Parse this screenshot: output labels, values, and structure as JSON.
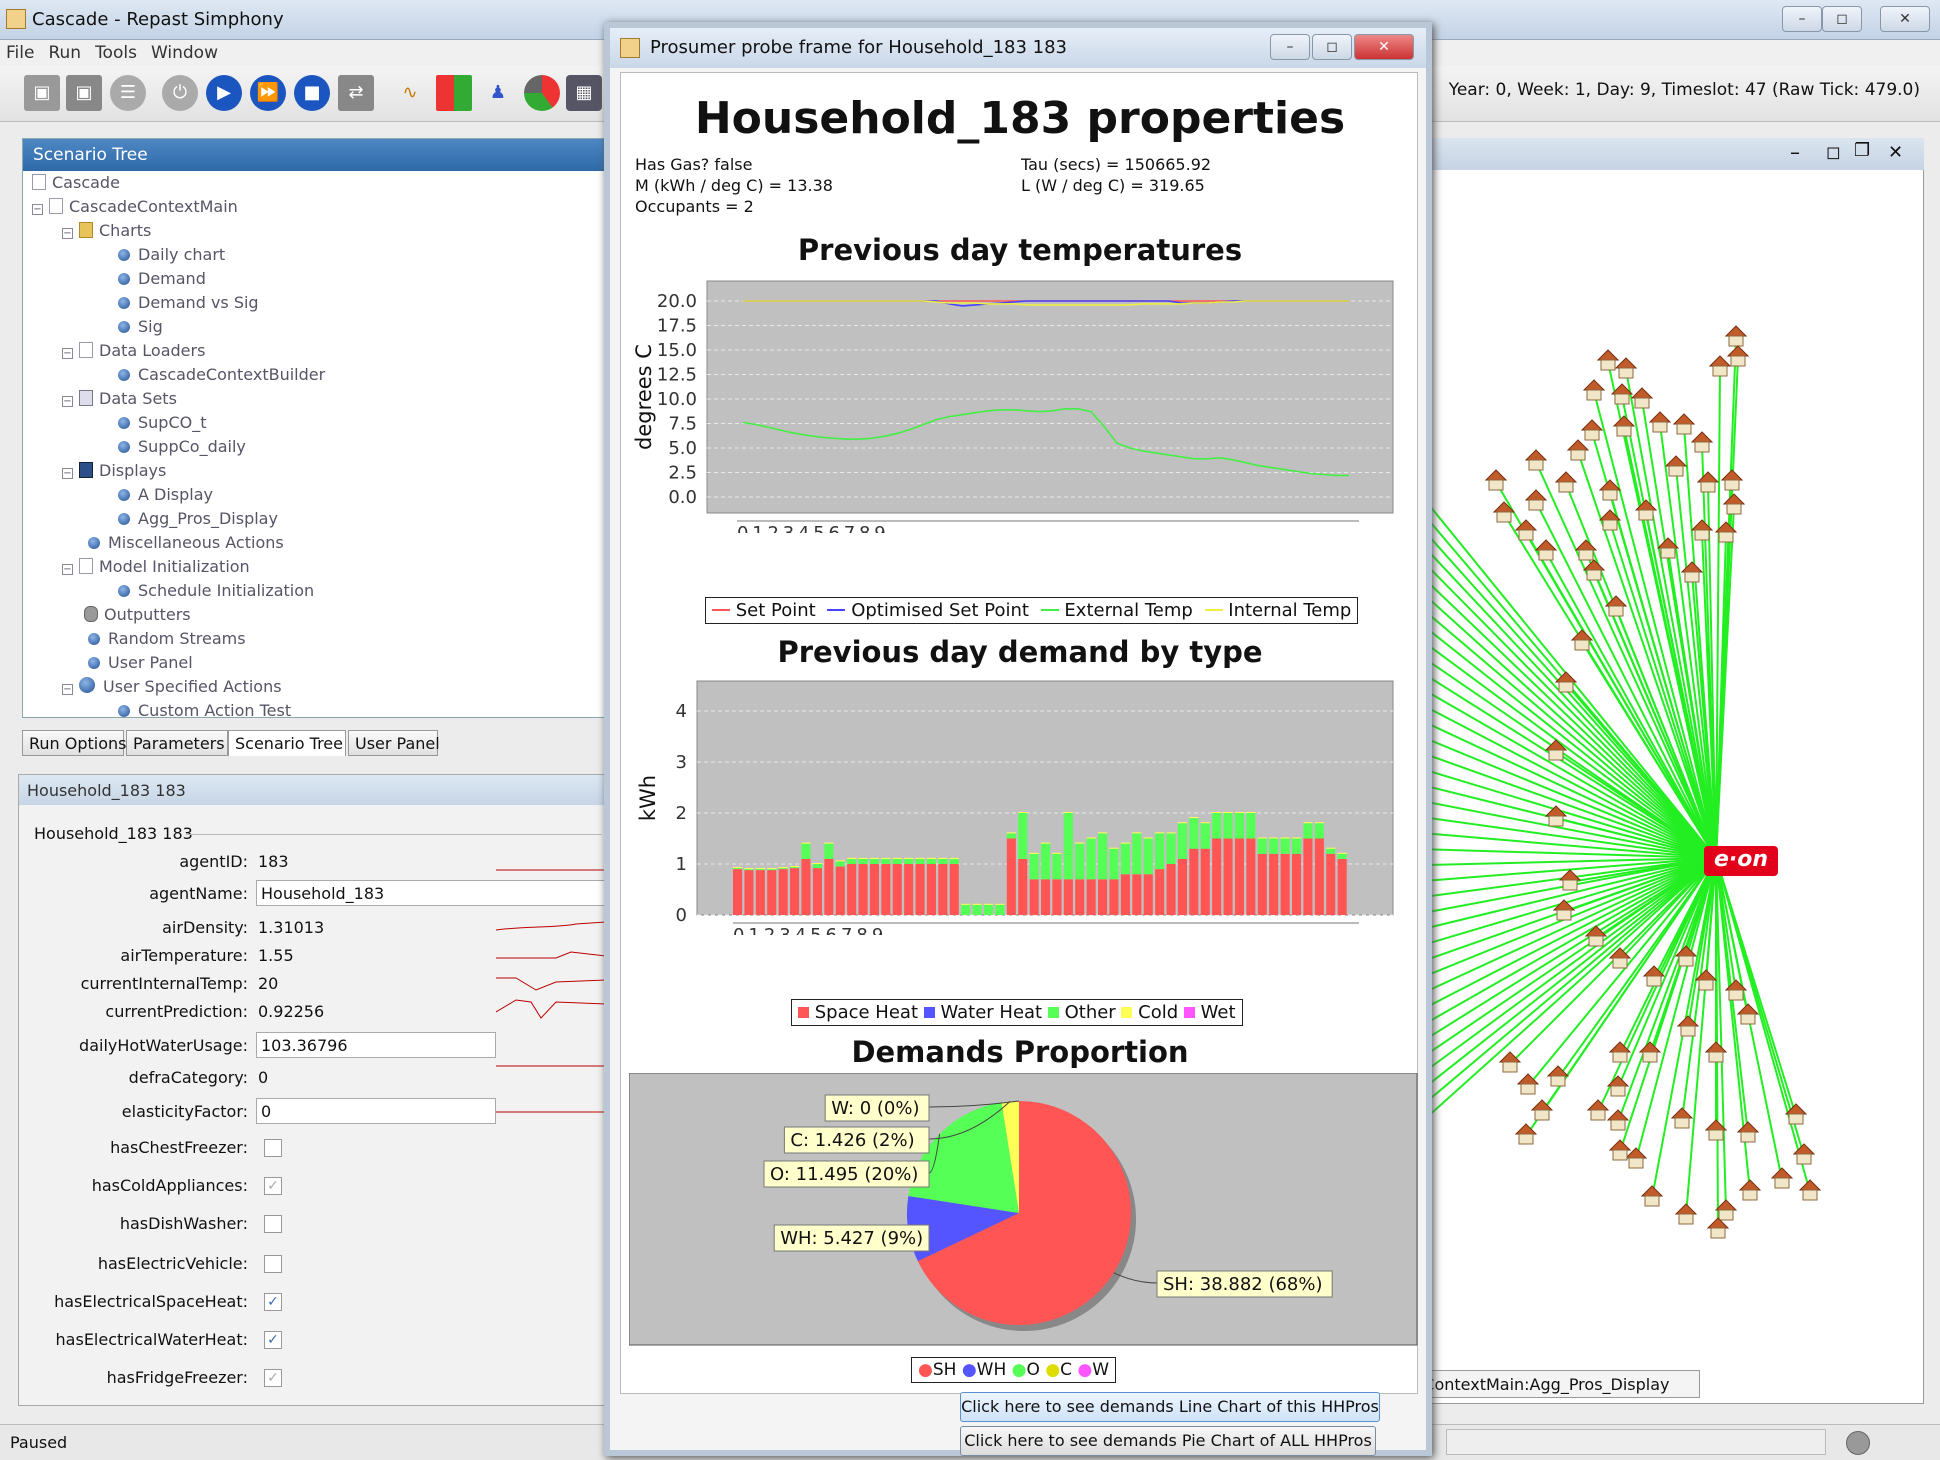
{
  "window": {
    "title": "Cascade - Repast Simphony",
    "menu": [
      "File",
      "Run",
      "Tools",
      "Window"
    ]
  },
  "tick_info": "Year: 0, Week: 1, Day: 9, Timeslot: 47 (Raw Tick: 479.0)",
  "scenario_tree": {
    "header": "Scenario Tree",
    "items": [
      "Cascade",
      "CascadeContextMain",
      "Charts",
      "Daily chart",
      "Demand",
      "Demand vs Sig",
      "Sig",
      "Data Loaders",
      "CascadeContextBuilder",
      "Data Sets",
      "SupCO_t",
      "SuppCo_daily",
      "Displays",
      "A Display",
      "Agg_Pros_Display",
      "Miscellaneous Actions",
      "Model Initialization",
      "Schedule Initialization",
      "Outputters",
      "Random Streams",
      "User Panel",
      "User Specified Actions",
      "Custom Action Test"
    ]
  },
  "tabs": [
    "Run Options",
    "Parameters",
    "Scenario Tree",
    "User Panel"
  ],
  "props_panel": {
    "header": "Household_183 183",
    "group": "Household_183 183",
    "rows": [
      {
        "label": "agentID:",
        "value": "183"
      },
      {
        "label": "agentName:",
        "value": "Household_183"
      },
      {
        "label": "airDensity:",
        "value": "1.31013"
      },
      {
        "label": "airTemperature:",
        "value": "1.55"
      },
      {
        "label": "currentInternalTemp:",
        "value": "20"
      },
      {
        "label": "currentPrediction:",
        "value": "0.92256"
      },
      {
        "label": "dailyHotWaterUsage:",
        "value": "103.36796"
      },
      {
        "label": "defraCategory:",
        "value": "0"
      },
      {
        "label": "elasticityFactor:",
        "value": "0"
      },
      {
        "label": "hasChestFreezer:",
        "checked": false
      },
      {
        "label": "hasColdAppliances:",
        "checked": true
      },
      {
        "label": "hasDishWasher:",
        "checked": false
      },
      {
        "label": "hasElectricVehicle:",
        "checked": false
      },
      {
        "label": "hasElectricalSpaceHeat:",
        "checked": true
      },
      {
        "label": "hasElectricalWaterHeat:",
        "checked": true
      },
      {
        "label": "hasFridgeFreezer:",
        "checked": true
      }
    ]
  },
  "status": "Paused",
  "net_display": {
    "tab": "leContextMain:Agg_Pros_Display",
    "logo": "e·on"
  },
  "probe": {
    "title": "Prosumer probe frame for Household_183 183",
    "heading": "Household_183 properties",
    "info_left": [
      "Has Gas? false",
      "M (kWh / deg C) = 13.38",
      "Occupants = 2"
    ],
    "info_right": [
      "Tau (secs) = 150665.92",
      "L (W / deg C) = 319.65"
    ],
    "button1": "Click here to see demands Line Chart of this HHPros",
    "button2": "Click here to see demands Pie Chart of  ALL HHPros"
  },
  "chart_data": [
    {
      "type": "line",
      "title": "Previous day temperatures",
      "xlabel": "Half hour",
      "ylabel": "degrees C",
      "ylim": [
        0,
        20
      ],
      "yticks": [
        "0.0",
        "2.5",
        "5.0",
        "7.5",
        "10.0",
        "12.5",
        "15.0",
        "17.5",
        "20.0"
      ],
      "x_tick_text": "0123456789.................................................",
      "colors": [
        "#ff5555",
        "#4444ff",
        "#44ee44",
        "#eeee44"
      ],
      "series": [
        {
          "name": "Set Point",
          "values": [
            20,
            20,
            20,
            20,
            20,
            20,
            20,
            20,
            20,
            20,
            20,
            20,
            20,
            20,
            20,
            20,
            20,
            20,
            20,
            20,
            20,
            20,
            20,
            20,
            20,
            20,
            20,
            20,
            20,
            20,
            20,
            20,
            20,
            20,
            20,
            20,
            20,
            20,
            20,
            20,
            20,
            20,
            20,
            20,
            20,
            20,
            20,
            20
          ]
        },
        {
          "name": "Optimised Set Point",
          "values": [
            20,
            20,
            20,
            20,
            20,
            20,
            20,
            20,
            20,
            20,
            20,
            20,
            20,
            20,
            20,
            20,
            19.7,
            19.5,
            19.6,
            19.7,
            19.8,
            19.9,
            20,
            20,
            20,
            20,
            20,
            20,
            20,
            20,
            20,
            20,
            20,
            20,
            19.8,
            19.8,
            19.8,
            19.9,
            20,
            20,
            20,
            20,
            20,
            20,
            20,
            20,
            20,
            20
          ]
        },
        {
          "name": "External Temp",
          "values": [
            7.6,
            7.4,
            7.1,
            6.8,
            6.5,
            6.3,
            6.1,
            6.0,
            5.9,
            5.9,
            6.0,
            6.2,
            6.5,
            6.9,
            7.4,
            7.9,
            8.2,
            8.4,
            8.6,
            8.8,
            8.9,
            8.9,
            8.8,
            8.7,
            8.8,
            9.0,
            9.0,
            8.7,
            7.2,
            5.5,
            5.0,
            4.7,
            4.5,
            4.3,
            4.1,
            3.9,
            3.9,
            4.0,
            3.8,
            3.5,
            3.2,
            3.0,
            2.8,
            2.6,
            2.4,
            2.3,
            2.2,
            2.2
          ]
        },
        {
          "name": "Internal Temp",
          "values": [
            20,
            20,
            20,
            20,
            20,
            20,
            20,
            20,
            20,
            20,
            20,
            20,
            20,
            20,
            20,
            19.9,
            19.8,
            19.8,
            19.8,
            19.7,
            19.7,
            19.7,
            19.6,
            19.6,
            19.6,
            19.6,
            19.6,
            19.6,
            19.6,
            19.6,
            19.6,
            19.7,
            19.7,
            19.7,
            19.7,
            19.8,
            19.8,
            19.9,
            19.9,
            20,
            20,
            20,
            20,
            20,
            20,
            20,
            20,
            20
          ]
        }
      ]
    },
    {
      "type": "bar",
      "title": "Previous day demand by type",
      "xlabel": "Half hour",
      "ylabel": "kWh",
      "ylim": [
        0,
        4
      ],
      "yticks": [
        "0",
        "1",
        "2",
        "3",
        "4"
      ],
      "x_tick_text": "0123456789.................................................",
      "colors": [
        "#ff5555",
        "#5555ff",
        "#55ff55",
        "#ffff55",
        "#ff55ff"
      ],
      "series": [
        {
          "name": "Space Heat",
          "values": [
            0.9,
            0.88,
            0.88,
            0.88,
            0.9,
            0.92,
            1.1,
            0.92,
            1.1,
            0.95,
            1.0,
            1.0,
            1.0,
            1.0,
            1.0,
            1.0,
            1.0,
            1.0,
            1.0,
            1.0,
            0,
            0,
            0,
            0,
            1.5,
            1.1,
            0.7,
            0.7,
            0.7,
            0.7,
            0.7,
            0.7,
            0.7,
            0.7,
            0.8,
            0.8,
            0.8,
            0.9,
            1.0,
            1.1,
            1.3,
            1.3,
            1.5,
            1.5,
            1.5,
            1.5,
            1.2,
            1.2,
            1.2,
            1.2,
            1.5,
            1.5,
            1.2,
            1.1
          ]
        },
        {
          "name": "Water Heat",
          "values": [
            0,
            0,
            0,
            0,
            0,
            0,
            0,
            0,
            0,
            0,
            0,
            0,
            0,
            0,
            0,
            0,
            0,
            0,
            0,
            0,
            0,
            0,
            0,
            0,
            0,
            0,
            0,
            0,
            0,
            0,
            0,
            0,
            0,
            0,
            0,
            0,
            0,
            0,
            0,
            0,
            0,
            0,
            0,
            0,
            0,
            0,
            0,
            0,
            0,
            0,
            0,
            0,
            0,
            0,
            1.9
          ]
        },
        {
          "name": "Other",
          "values": [
            0.02,
            0.02,
            0.02,
            0.02,
            0.02,
            0.02,
            0.3,
            0.08,
            0.3,
            0.1,
            0.1,
            0.1,
            0.1,
            0.1,
            0.1,
            0.1,
            0.1,
            0.1,
            0.1,
            0.1,
            0.2,
            0.2,
            0.2,
            0.2,
            0.1,
            0.9,
            0.5,
            0.7,
            0.5,
            1.3,
            0.7,
            0.8,
            0.9,
            0.6,
            0.6,
            0.8,
            0.7,
            0.7,
            0.6,
            0.7,
            0.6,
            0.5,
            0.5,
            0.5,
            0.5,
            0.5,
            0.3,
            0.3,
            0.3,
            0.3,
            0.3,
            0.3,
            0.1,
            0.1
          ]
        },
        {
          "name": "Cold",
          "values": [
            0.02,
            0.02,
            0.02,
            0.02,
            0.02,
            0.02,
            0.02,
            0.02,
            0.02,
            0.02,
            0.02,
            0.02,
            0.02,
            0.02,
            0.02,
            0.02,
            0.02,
            0.02,
            0.02,
            0.02,
            0.02,
            0.02,
            0.02,
            0.02,
            0.02,
            0.02,
            0.02,
            0.02,
            0.02,
            0.02,
            0.02,
            0.02,
            0.02,
            0.02,
            0.02,
            0.02,
            0.02,
            0.02,
            0.02,
            0.02,
            0.02,
            0.02,
            0.02,
            0.02,
            0.02,
            0.02,
            0.02,
            0.02,
            0.02,
            0.02,
            0.02,
            0.02,
            0.02,
            0.02
          ]
        },
        {
          "name": "Wet",
          "values": [
            0,
            0,
            0,
            0,
            0,
            0,
            0,
            0,
            0,
            0,
            0,
            0,
            0,
            0,
            0,
            0,
            0,
            0,
            0,
            0,
            0,
            0,
            0,
            0,
            0,
            0,
            0,
            0,
            0,
            0,
            0,
            0,
            0,
            0,
            0,
            0,
            0,
            0,
            0,
            0,
            0,
            0,
            0,
            0,
            0,
            0,
            0,
            0,
            0,
            0,
            0,
            0,
            0,
            0
          ]
        }
      ]
    },
    {
      "type": "pie",
      "title": "Demands Proportion",
      "colors": [
        "#ff5555",
        "#5555ff",
        "#55ff55",
        "#ffff55",
        "#ff55ff"
      ],
      "slices": [
        {
          "name": "SH",
          "value": 38.882,
          "label": "SH: 38.882 (68%)"
        },
        {
          "name": "WH",
          "value": 5.427,
          "label": "WH: 5.427 (9%)"
        },
        {
          "name": "O",
          "value": 11.495,
          "label": "O: 11.495 (20%)"
        },
        {
          "name": "C",
          "value": 1.426,
          "label": "C: 1.426 (2%)"
        },
        {
          "name": "W",
          "value": 0,
          "label": "W: 0 (0%)"
        }
      ]
    }
  ]
}
